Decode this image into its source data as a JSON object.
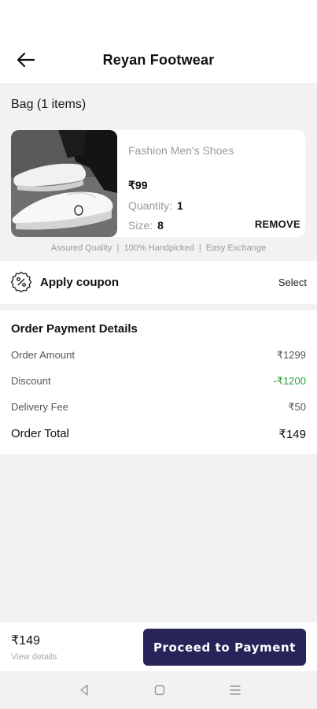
{
  "header": {
    "title": "Reyan Footwear"
  },
  "bag": {
    "title": "Bag (1 items)",
    "product": {
      "name": "Fashion Men's Shoes",
      "price": "₹99",
      "quantity_label": "Quantity:",
      "quantity_value": "1",
      "size_label": "Size:",
      "size_value": "8",
      "remove_label": "REMOVE"
    },
    "assurance": "Assured Quality  |  100% Handpicked  |  Easy Exchange"
  },
  "coupon": {
    "label": "Apply coupon",
    "select_label": "Select"
  },
  "order": {
    "title": "Order Payment Details",
    "rows": [
      {
        "label": "Order Amount",
        "value": "₹1299"
      },
      {
        "label": "Discount",
        "value": "-₹1200"
      },
      {
        "label": "Delivery Fee",
        "value": "₹50"
      }
    ],
    "total_label": "Order Total",
    "total_value": "₹149"
  },
  "bottom": {
    "price": "₹149",
    "details_label": "View details",
    "proceed_label": "Proceed to Payment"
  },
  "colors": {
    "primary": "#27245a",
    "discount": "#2a9d3a"
  }
}
